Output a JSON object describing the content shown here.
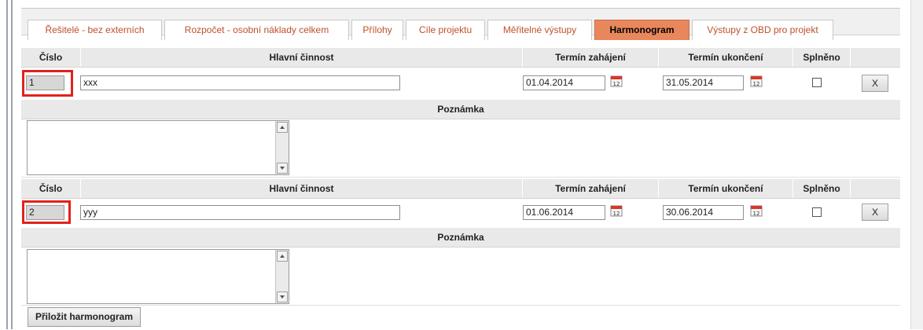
{
  "tabs": [
    {
      "label": "Řešitelé - bez externích",
      "active": false
    },
    {
      "label": "Rozpočet - osobní náklady celkem",
      "active": false
    },
    {
      "label": "Přílohy",
      "active": false
    },
    {
      "label": "Cíle projektu",
      "active": false
    },
    {
      "label": "Měřitelné výstupy",
      "active": false
    },
    {
      "label": "Harmonogram",
      "active": true
    },
    {
      "label": "Výstupy z OBD pro projekt",
      "active": false
    }
  ],
  "columns": {
    "number": "Číslo",
    "activity": "Hlavní činnost",
    "start": "Termín zahájení",
    "end": "Termín ukončení",
    "done": "Splněno"
  },
  "note_label": "Poznámka",
  "rows": [
    {
      "number": "1",
      "activity": "xxx",
      "start": "01.04.2014",
      "end": "31.05.2014",
      "done": false,
      "delete_label": "X",
      "note": ""
    },
    {
      "number": "2",
      "activity": "yyy",
      "start": "01.06.2014",
      "end": "30.06.2014",
      "done": false,
      "delete_label": "X",
      "note": ""
    }
  ],
  "attach_button": "Přiložit harmonogram",
  "icons": {
    "calendar": "calendar-icon",
    "scroll_up": "scroll-up-icon",
    "scroll_down": "scroll-down-icon"
  },
  "colors": {
    "active_tab": "#e9875c",
    "tab_text": "#c0502a",
    "highlight": "#e2211c"
  }
}
